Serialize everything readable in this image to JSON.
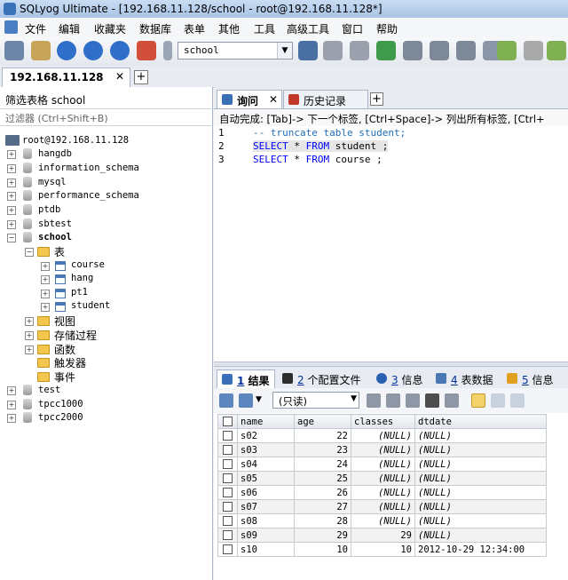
{
  "window": {
    "title": "SQLyog Ultimate - [192.168.11.128/school - root@192.168.11.128*]"
  },
  "menu": [
    "文件",
    "编辑",
    "收藏夹",
    "数据库",
    "表单",
    "其他",
    "工具",
    "高级工具",
    "窗口",
    "帮助"
  ],
  "toolbar": {
    "database_selected": "school"
  },
  "connection_tab": {
    "label": "192.168.11.128",
    "close": "✕",
    "add": "+"
  },
  "object_browser": {
    "filter_label": "筛选表格 school",
    "filter_placeholder": "过滤器 (Ctrl+Shift+B)",
    "root": "root@192.168.11.128",
    "databases": [
      "hangdb",
      "information_schema",
      "mysql",
      "performance_schema",
      "ptdb",
      "sbtest",
      "school",
      "test",
      "tpcc1000",
      "tpcc2000"
    ],
    "expanded_db": "school",
    "folders": {
      "tables": "表",
      "views": "视图",
      "procedures": "存储过程",
      "functions": "函数",
      "triggers": "触发器",
      "events": "事件"
    },
    "tables": [
      "course",
      "hang",
      "pt1",
      "student"
    ]
  },
  "query_tabs": [
    {
      "label": "询问",
      "close": "✕"
    },
    {
      "label": "历史记录"
    }
  ],
  "query_tab_add": "+",
  "autocomplete_hint": "自动完成: [Tab]-> 下一个标签, [Ctrl+Space]-> 列出所有标签, [Ctrl+",
  "editor": {
    "lines": [
      {
        "no": "1",
        "comment": "-- truncate table student;"
      },
      {
        "no": "2",
        "kw1": "SELECT",
        "mid": " * ",
        "kw2": "FROM",
        "rest": " student ;"
      },
      {
        "no": "3",
        "kw1": "SELECT",
        "mid": " * ",
        "kw2": "FROM",
        "rest": " course ;"
      }
    ]
  },
  "result_tabs": [
    {
      "num": "1",
      "label": "结果"
    },
    {
      "num": "2",
      "label": "个配置文件"
    },
    {
      "num": "3",
      "label": "信息"
    },
    {
      "num": "4",
      "label": "表数据"
    },
    {
      "num": "5",
      "label": "信息"
    }
  ],
  "result_toolbar": {
    "mode": "(只读)"
  },
  "grid": {
    "columns": [
      "name",
      "age",
      "classes",
      "dtdate"
    ],
    "rows": [
      [
        "s02",
        "22",
        "(NULL)",
        "(NULL)"
      ],
      [
        "s03",
        "23",
        "(NULL)",
        "(NULL)"
      ],
      [
        "s04",
        "24",
        "(NULL)",
        "(NULL)"
      ],
      [
        "s05",
        "25",
        "(NULL)",
        "(NULL)"
      ],
      [
        "s06",
        "26",
        "(NULL)",
        "(NULL)"
      ],
      [
        "s07",
        "27",
        "(NULL)",
        "(NULL)"
      ],
      [
        "s08",
        "28",
        "(NULL)",
        "(NULL)"
      ],
      [
        "s09",
        "29",
        "29",
        "(NULL)"
      ],
      [
        "s10",
        "10",
        "10",
        "2012-10-29 12:34:00"
      ]
    ]
  }
}
